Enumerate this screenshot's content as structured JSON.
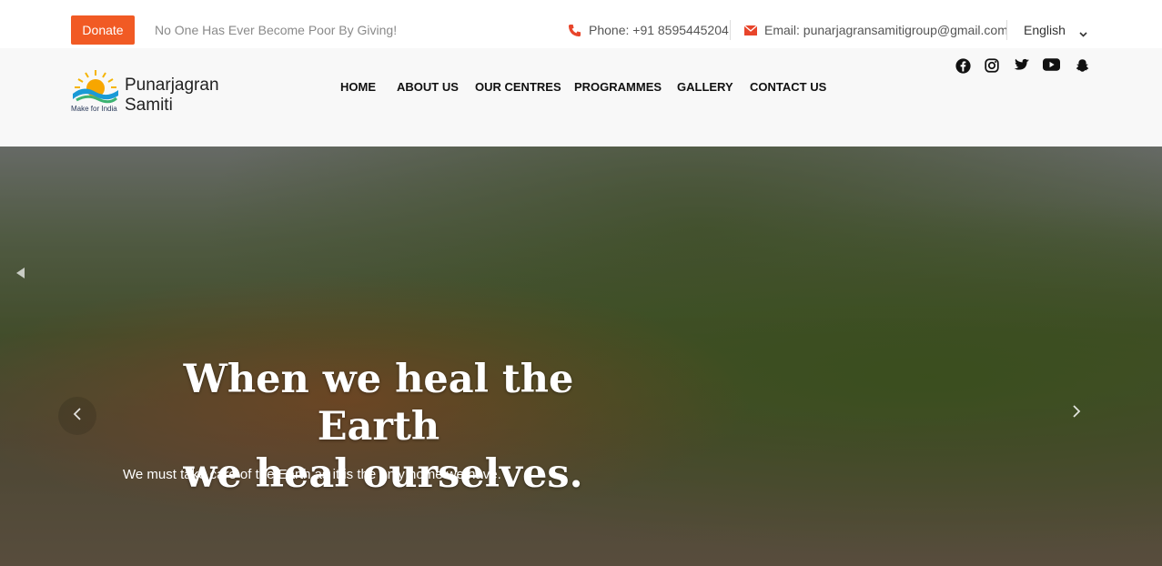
{
  "topbar": {
    "donate_label": "Donate",
    "tagline": "No One Has Ever Become Poor By Giving!",
    "phone": "Phone: +91 8595445204",
    "email": "Email: punarjagransamitigroup@gmail.com",
    "language": "English"
  },
  "brand": {
    "name_line1": "Punarjagran",
    "name_line2": "Samiti",
    "subtitle": "Make for India"
  },
  "nav": {
    "items": [
      "HOME",
      "ABOUT US",
      "OUR CENTRES",
      "PROGRAMMES",
      "GALLERY",
      "CONTACT US"
    ]
  },
  "social": [
    "facebook-icon",
    "instagram-icon",
    "twitter-icon",
    "youtube-icon",
    "snapchat-icon"
  ],
  "hero": {
    "title_line1": "When we heal the Earth",
    "title_line2": "we heal ourselves.",
    "subtitle": "We must take care of the Earth as it is the only home we have."
  },
  "colors": {
    "accent": "#f15a24",
    "header_bg": "#f8f8f8"
  }
}
